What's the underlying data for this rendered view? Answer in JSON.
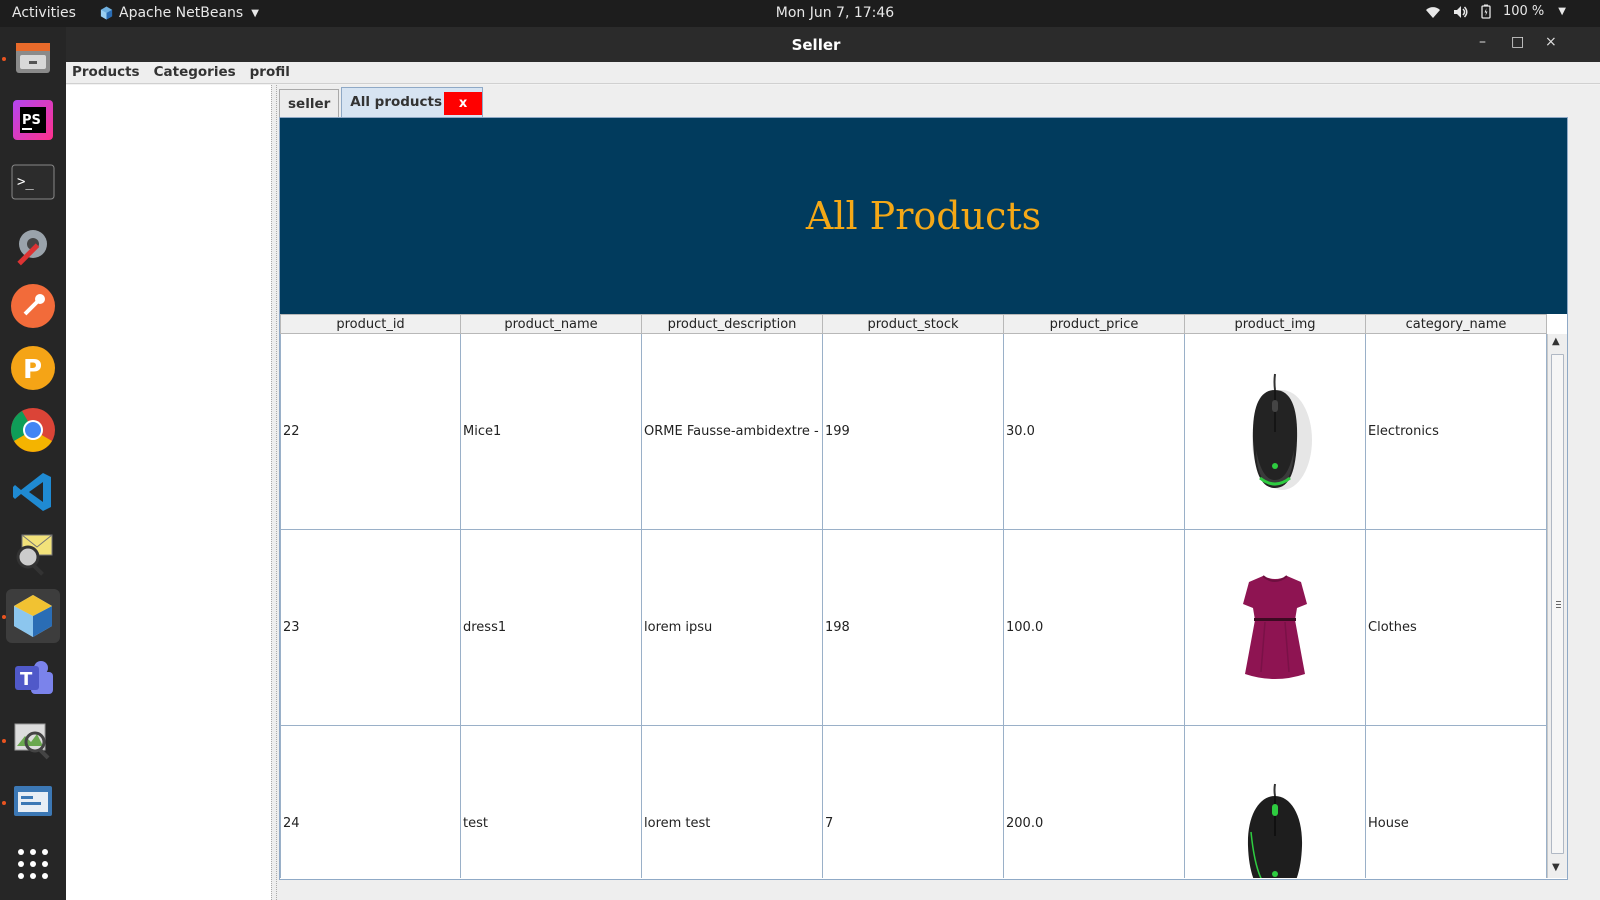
{
  "topbar": {
    "activities": "Activities",
    "app_name": "Apache NetBeans",
    "clock": "Mon Jun  7, 17:46",
    "battery": "100 %"
  },
  "dock": {
    "items": [
      {
        "name": "files-icon"
      },
      {
        "name": "phpstorm-icon"
      },
      {
        "name": "terminal-icon"
      },
      {
        "name": "settings-tools-icon"
      },
      {
        "name": "postman-icon"
      },
      {
        "name": "pencil-app-icon"
      },
      {
        "name": "chrome-icon"
      },
      {
        "name": "vscode-icon"
      },
      {
        "name": "mail-search-icon"
      },
      {
        "name": "netbeans-icon"
      },
      {
        "name": "teams-icon"
      },
      {
        "name": "image-viewer-icon"
      },
      {
        "name": "screenshot-icon"
      },
      {
        "name": "show-apps-icon"
      }
    ]
  },
  "window": {
    "title": "Seller",
    "minimize": "–",
    "maximize": "□",
    "close": "×"
  },
  "menubar": {
    "items": [
      "Products",
      "Categories",
      "profil"
    ]
  },
  "tabs": {
    "seller": "seller",
    "all_products": "All products",
    "close_label": "x"
  },
  "header": {
    "title": "All Products"
  },
  "table": {
    "columns": [
      "product_id",
      "product_name",
      "product_description",
      "product_stock",
      "product_price",
      "product_img",
      "category_name"
    ],
    "rows": [
      {
        "id": "22",
        "name": "Mice1",
        "description": "ORME Fausse-ambidextre - ...",
        "stock": "199",
        "price": "30.0",
        "img": "mouse-product-image",
        "category": "Electronics"
      },
      {
        "id": "23",
        "name": "dress1",
        "description": "lorem ipsu",
        "stock": "198",
        "price": "100.0",
        "img": "dress-product-image",
        "category": "Clothes"
      },
      {
        "id": "24",
        "name": "test",
        "description": "lorem test",
        "stock": "7",
        "price": "200.0",
        "img": "mouse-product-image",
        "category": "House"
      }
    ]
  },
  "colors": {
    "header_bg": "#013b5d",
    "header_title": "#f4a817",
    "tab_close_bg": "#ff0000",
    "dress": "#8e1452"
  }
}
